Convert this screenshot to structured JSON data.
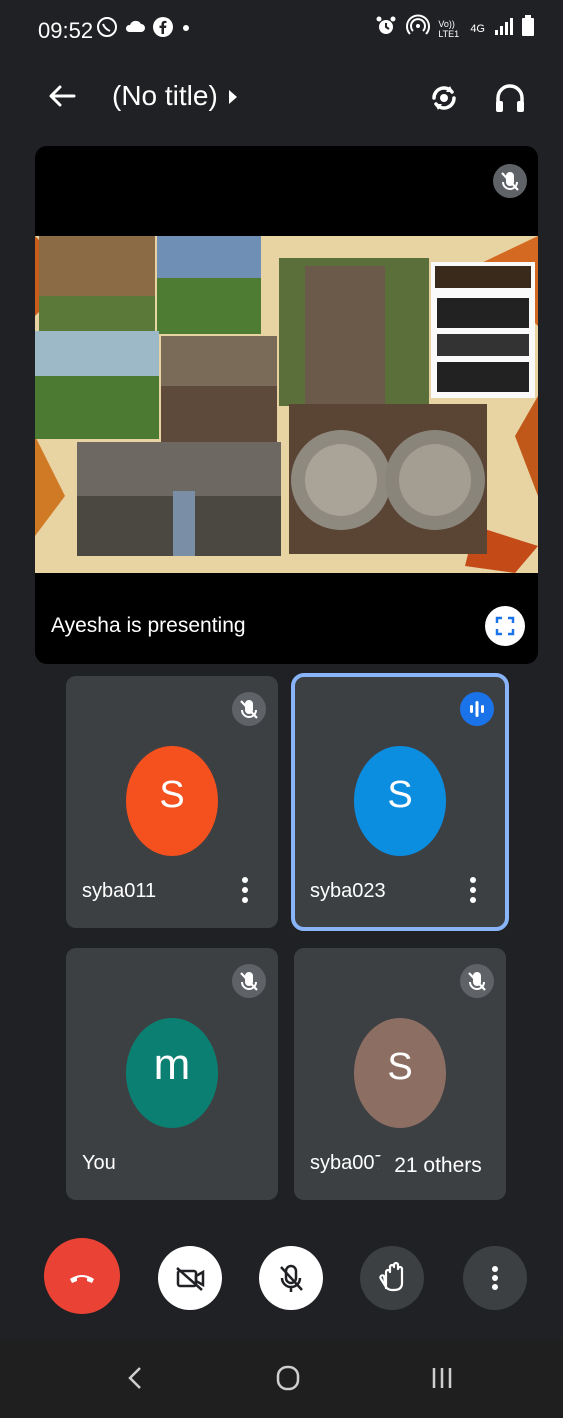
{
  "status_bar": {
    "time": "09:52",
    "left_icons": [
      "whatsapp-icon",
      "cloud-icon",
      "facebook-icon",
      "dot-icon"
    ],
    "right_icons": [
      "alarm-icon",
      "hotspot-icon",
      "volte-icon",
      "network-4g-icon",
      "signal-icon",
      "battery-icon"
    ],
    "volte_text": "Vo)) LTE1",
    "network_text": "4G"
  },
  "top_bar": {
    "title": "(No title)"
  },
  "presentation": {
    "label": "Ayesha is presenting"
  },
  "participants": [
    {
      "name": "syba011",
      "initial": "S",
      "avatar_color": "#f4511e",
      "muted": true,
      "speaking": false
    },
    {
      "name": "syba023",
      "initial": "S",
      "avatar_color": "#0b8de0",
      "muted": false,
      "speaking": true
    },
    {
      "name": "You",
      "initial": "m",
      "avatar_color": "#0b8072",
      "muted": true,
      "speaking": false
    },
    {
      "name": "syba007",
      "initial": "S",
      "avatar_color": "#8d6e63",
      "muted": true,
      "speaking": false
    }
  ],
  "others_chip": "21 others",
  "colors": {
    "background": "#202124",
    "tile": "#3c4043",
    "end_call": "#ea4335",
    "active_speaker_border": "#8ab4f8",
    "speaking_badge": "#1a73e8"
  }
}
